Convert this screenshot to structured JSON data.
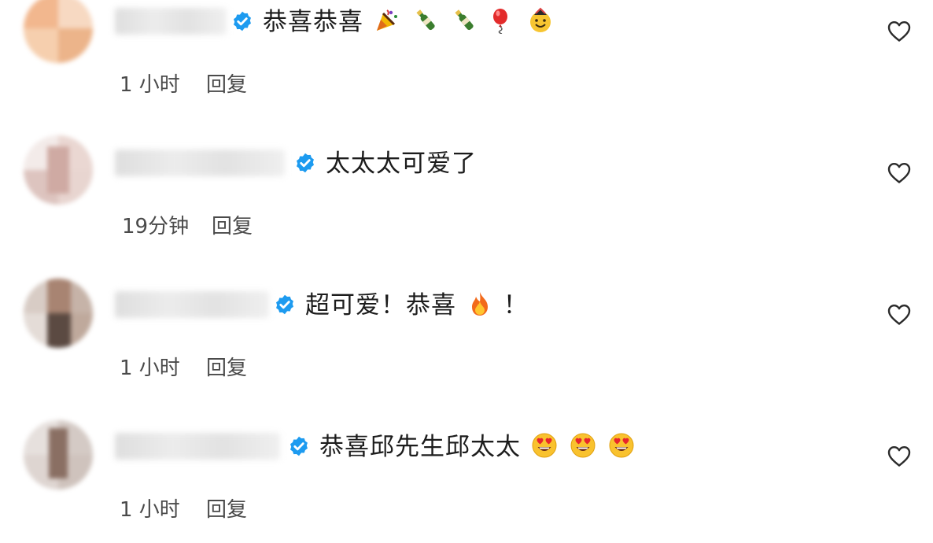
{
  "comments": [
    {
      "text": "恭喜恭喜",
      "time": "1 小时",
      "reply": "回复",
      "emoji_icons": [
        "party-popper-icon",
        "champagne-bottle-icon",
        "champagne-bottle-icon",
        "balloon-icon",
        "party-face-icon"
      ]
    },
    {
      "text": "太太太可爱了",
      "time": "19分钟",
      "reply": "回复",
      "emoji_icons": []
    },
    {
      "text": "超可爱！恭喜",
      "text_suffix": "！",
      "time": "1 小时",
      "reply": "回复",
      "emoji_icons": [
        "fire-icon"
      ]
    },
    {
      "text": "恭喜邱先生邱太太",
      "time": "1 小时",
      "reply": "回复",
      "emoji_icons": [
        "heart-eyes-face-icon",
        "heart-eyes-face-icon",
        "heart-eyes-face-icon"
      ]
    }
  ],
  "colors": {
    "verified_badge": "#1d9bf0",
    "meta_text": "#4a4a4a",
    "heart_outline": "#2a2a2a"
  }
}
